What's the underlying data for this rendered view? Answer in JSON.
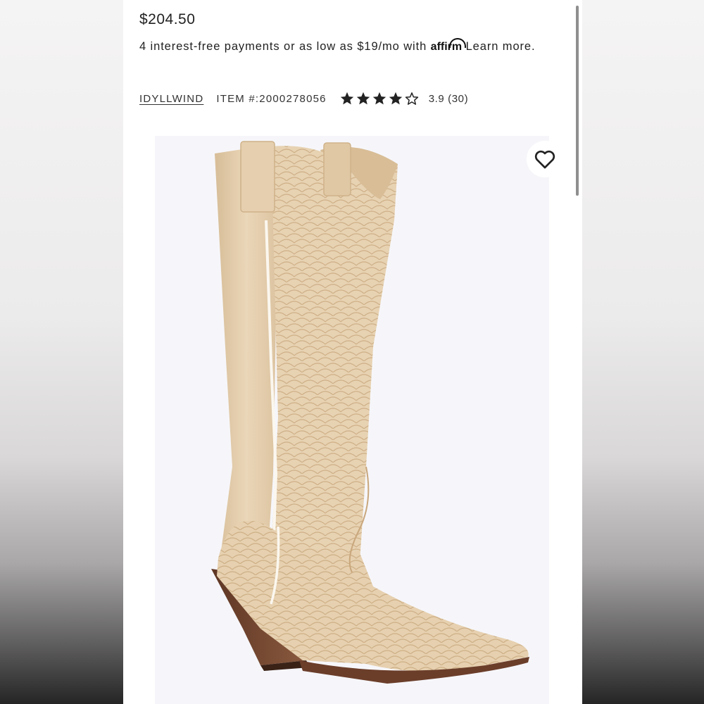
{
  "product": {
    "price": "$204.50",
    "affirm": {
      "text_before": "4 interest-free payments or as low as $19/mo with ",
      "logo_text": "affirm",
      "link_text": " Learn more."
    },
    "brand": "IDYLLWIND",
    "item_number": "ITEM #:2000278056",
    "rating": {
      "stars": 3.9,
      "text": "3.9 (30)"
    }
  },
  "image": {
    "subject": "tan snake-embossed western cowboy boot",
    "wishlist_icon": "heart-icon"
  },
  "colors": {
    "boot_tan": "#e6cfae",
    "heel_brown": "#7a4a32",
    "star_fill": "#222222"
  }
}
